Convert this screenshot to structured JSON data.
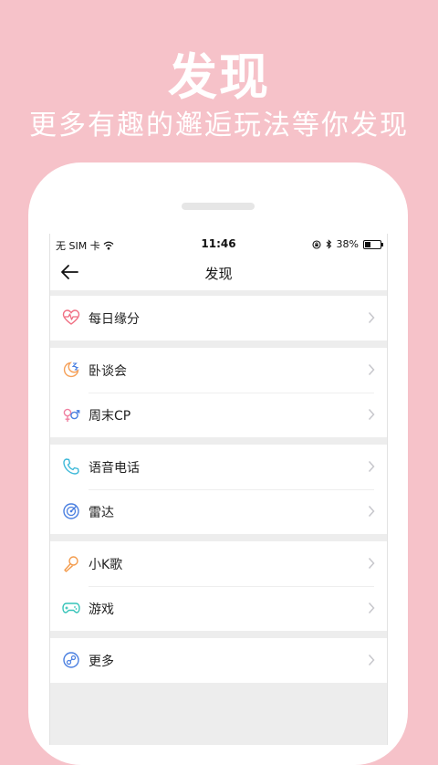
{
  "hero": {
    "title": "发现",
    "subtitle": "更多有趣的邂逅玩法等你发现"
  },
  "status_bar": {
    "carrier": "无 SIM 卡",
    "time": "11:46",
    "battery": "38%",
    "battery_level": 0.38,
    "icons": [
      "wifi-icon",
      "lock-rotation-icon",
      "bluetooth-icon",
      "battery-icon"
    ]
  },
  "nav": {
    "title": "发现",
    "back_icon": "back-arrow-icon"
  },
  "menu": {
    "groups": [
      {
        "items": [
          {
            "label": "每日缘分",
            "icon": "heartbeat-icon",
            "color": "#f06e82"
          }
        ]
      },
      {
        "items": [
          {
            "label": "卧谈会",
            "icon": "moon-night-icon",
            "color": "#f5a15a"
          },
          {
            "label": "周末CP",
            "icon": "gender-couple-icon",
            "color": "#ef7fa0"
          }
        ]
      },
      {
        "items": [
          {
            "label": "语音电话",
            "icon": "phone-icon",
            "color": "#3cb8d8"
          },
          {
            "label": "雷达",
            "icon": "radar-icon",
            "color": "#4a7fe0"
          }
        ]
      },
      {
        "items": [
          {
            "label": "小K歌",
            "icon": "microphone-icon",
            "color": "#f39a4a"
          },
          {
            "label": "游戏",
            "icon": "gamepad-icon",
            "color": "#34c3b8"
          }
        ]
      },
      {
        "items": [
          {
            "label": "更多",
            "icon": "more-icon",
            "color": "#4a7fe0"
          }
        ]
      }
    ]
  },
  "colors": {
    "background": "#f6c2c9",
    "phone": "#ffffff",
    "screen_bg": "#ededed",
    "chevron": "#c7c7cc"
  }
}
